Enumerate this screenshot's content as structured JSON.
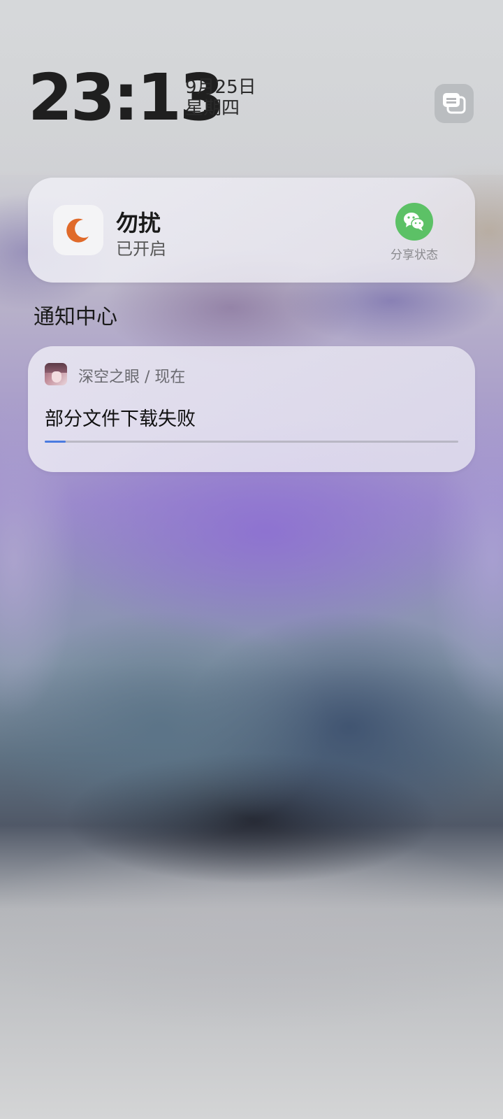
{
  "lockscreen": {
    "time": "23:13",
    "date": "9月25日",
    "weekday": "星期四"
  },
  "dnd_card": {
    "title": "勿扰",
    "status": "已开启",
    "icon": "moon-icon",
    "icon_color": "#e06a2a",
    "share_label": "分享状态",
    "share_icon": "wechat-icon",
    "share_color": "#5cc166"
  },
  "notification_center": {
    "title": "通知中心",
    "notifications": [
      {
        "app": "深空之眼",
        "time": "现在",
        "separator": " / ",
        "message": "部分文件下载失败",
        "progress": 0.05,
        "progress_color": "#4a7be0"
      }
    ]
  }
}
